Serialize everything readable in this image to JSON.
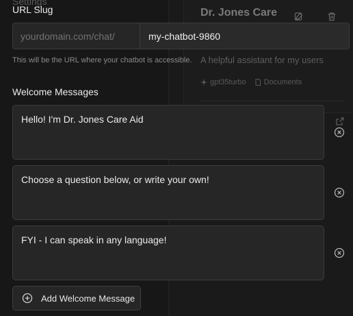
{
  "background": {
    "settings_label": "Settings",
    "bot_card": {
      "title": "Dr. Jones Care",
      "description": "A helpful assistant for my users",
      "model_tag": "gpt35turbo",
      "docs_tag": "Documents"
    }
  },
  "slug": {
    "label": "URL Slug",
    "prefix": "yourdomain.com/chat/",
    "value": "my-chatbot-9860",
    "help": "This will be the URL where your chatbot is accessible."
  },
  "welcome": {
    "label": "Welcome Messages",
    "messages": [
      {
        "text": "Hello! I'm Dr. Jones Care Aid"
      },
      {
        "text": "Choose a question below, or write your own!"
      },
      {
        "text": "FYI - I can speak in any language!"
      }
    ],
    "add_label": "Add Welcome Message"
  },
  "icons": {
    "remove": "close-circle-icon",
    "add": "plus-circle-icon",
    "edit": "edit-icon",
    "delete": "trash-icon",
    "external": "external-link-icon"
  },
  "colors": {
    "background": "#171717",
    "field_bg": "#262626",
    "border": "#3c3c3c",
    "text": "#ececec",
    "muted": "#8a8a8a"
  }
}
